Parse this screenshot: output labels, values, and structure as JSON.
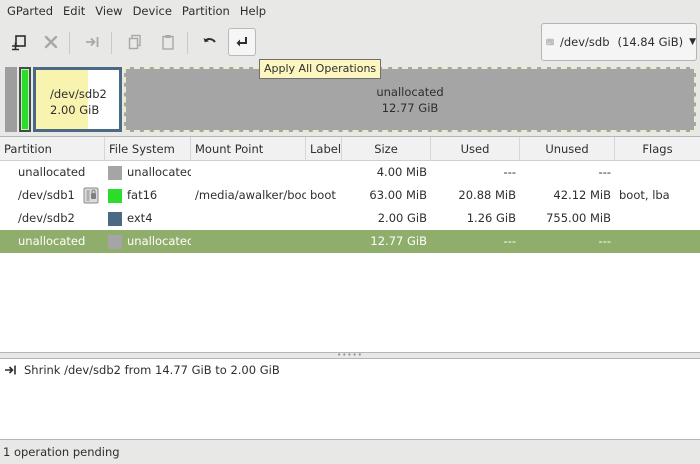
{
  "menubar": {
    "items": [
      "GParted",
      "Edit",
      "View",
      "Device",
      "Partition",
      "Help"
    ]
  },
  "toolbar": {
    "buttons": [
      {
        "icon": "new-partition-icon",
        "enabled": true
      },
      {
        "icon": "delete-icon",
        "enabled": false
      },
      {
        "icon": "resize-move-icon",
        "enabled": false
      },
      {
        "icon": "copy-icon",
        "enabled": false
      },
      {
        "icon": "paste-icon",
        "enabled": false
      },
      {
        "icon": "undo-icon",
        "enabled": true
      },
      {
        "icon": "apply-icon",
        "enabled": true
      }
    ],
    "tooltip": "Apply All Operations"
  },
  "device": {
    "name": "/dev/sdb",
    "size": "(14.84 GiB)",
    "icon": "harddisk-icon"
  },
  "map": {
    "sdb2": {
      "name": "/dev/sdb2",
      "size": "2.00 GiB"
    },
    "unallocated": {
      "name": "unallocated",
      "size": "12.77 GiB"
    }
  },
  "colors": {
    "fat16": "#2bdc2b",
    "ext4": "#4b6983",
    "unallocated": "#a5a5a5",
    "selection": "#8fae6b",
    "tooltip": "#fcf6c0"
  },
  "table": {
    "columns": [
      "Partition",
      "File System",
      "Mount Point",
      "Label",
      "Size",
      "Used",
      "Unused",
      "Flags"
    ],
    "rows": [
      {
        "partition": "unallocated",
        "fs": "unallocated",
        "fs_color": "#a5a5a5",
        "mount": "",
        "label": "",
        "size": "4.00 MiB",
        "used": "---",
        "unused": "---",
        "flags": "",
        "locked": false,
        "selected": false
      },
      {
        "partition": "/dev/sdb1",
        "fs": "fat16",
        "fs_color": "#2bdc2b",
        "mount": "/media/awalker/boot",
        "label": "boot",
        "size": "63.00 MiB",
        "used": "20.88 MiB",
        "unused": "42.12 MiB",
        "flags": "boot, lba",
        "locked": true,
        "selected": false
      },
      {
        "partition": "/dev/sdb2",
        "fs": "ext4",
        "fs_color": "#4b6983",
        "mount": "",
        "label": "",
        "size": "2.00 GiB",
        "used": "1.26 GiB",
        "unused": "755.00 MiB",
        "flags": "",
        "locked": false,
        "selected": false
      },
      {
        "partition": "unallocated",
        "fs": "unallocated",
        "fs_color": "#a5a5a5",
        "mount": "",
        "label": "",
        "size": "12.77 GiB",
        "used": "---",
        "unused": "---",
        "flags": "",
        "locked": false,
        "selected": true
      }
    ]
  },
  "operations": [
    {
      "icon": "resize-icon",
      "text": "Shrink /dev/sdb2 from 14.77 GiB to 2.00 GiB"
    }
  ],
  "status": "1 operation pending"
}
